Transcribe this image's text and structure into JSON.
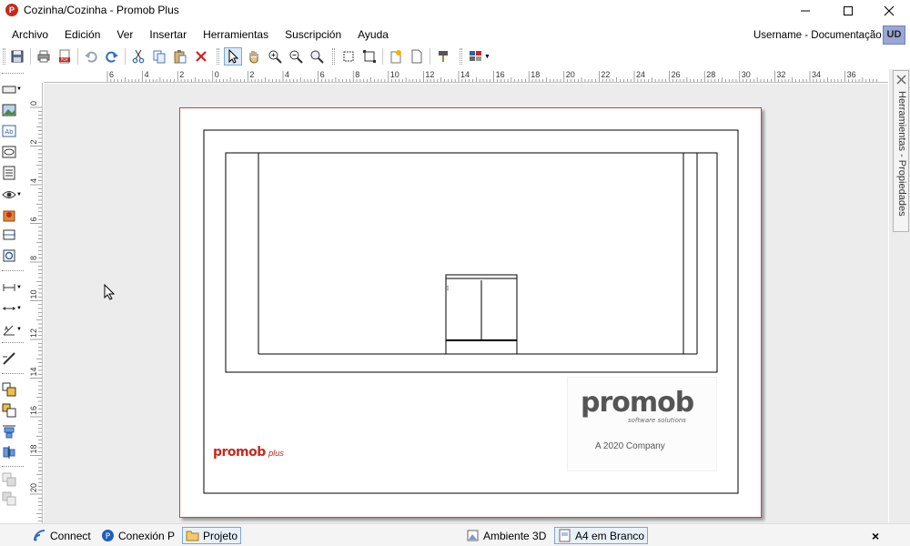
{
  "window": {
    "title": "Cozinha/Cozinha - Promob Plus",
    "app_icon": "promob-app-icon",
    "buttons": [
      "minimize-icon",
      "maximize-icon",
      "close-icon"
    ]
  },
  "menu": {
    "items": [
      "Archivo",
      "Edición",
      "Ver",
      "Insertar",
      "Herramientas",
      "Suscripción",
      "Ayuda"
    ],
    "user_label": "Username - Documentação",
    "user_initials": "UD"
  },
  "toolbar": {
    "icons": [
      "save-icon",
      "print-icon",
      "pdf-export-icon",
      "undo-icon",
      "redo-icon",
      "cut-icon",
      "copy-icon",
      "paste-icon",
      "delete-icon",
      "select-pointer-icon",
      "pan-hand-icon",
      "zoom-in-icon",
      "zoom-out-icon",
      "zoom-search-icon",
      "select-box-icon",
      "fit-area-icon",
      "properties-icon",
      "new-page-icon",
      "format-painter-icon",
      "color-palette-icon"
    ]
  },
  "rulers": {
    "top_labels": [
      "6",
      "4",
      "2",
      "0",
      "2",
      "4",
      "6",
      "8",
      "10",
      "12",
      "14",
      "16",
      "18",
      "20",
      "22",
      "24",
      "26",
      "28",
      "30",
      "32",
      "34",
      "36"
    ],
    "left_labels": [
      "0",
      "2",
      "4",
      "6",
      "8",
      "10",
      "12",
      "14",
      "16",
      "18",
      "20"
    ]
  },
  "side_panel": {
    "tab_label": "Herramientas - Propiedades"
  },
  "drawing": {
    "logo_main": "promob",
    "logo_sub": "software solutions",
    "logo_company": "A 2020 Company",
    "small_logo": "promob",
    "small_logo_suffix": "plus",
    "brand_red": "#c8281e",
    "border_red": "#d33b3b"
  },
  "statusbar": {
    "tabs": [
      {
        "label": "Connect",
        "icon": "connect-icon"
      },
      {
        "label": "Conexión P",
        "icon": "promob-connection-icon"
      },
      {
        "label": "Projeto",
        "icon": "folder-icon"
      }
    ],
    "views": [
      {
        "label": "Ambiente 3D",
        "icon": "3d-environment-icon"
      },
      {
        "label": "A4 em Branco",
        "icon": "sheet-icon"
      }
    ],
    "close_label": "×"
  }
}
